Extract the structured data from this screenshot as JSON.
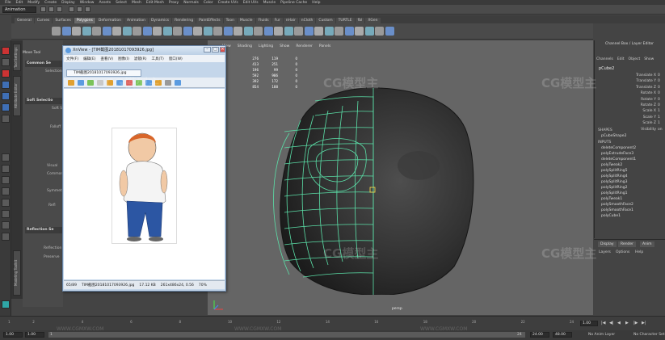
{
  "menubar": {
    "items": [
      "File",
      "Edit",
      "Modify",
      "Create",
      "Display",
      "Window",
      "Assets",
      "Select",
      "Mesh",
      "Edit Mesh",
      "Proxy",
      "Normals",
      "Color",
      "Create UVs",
      "Edit UVs",
      "Muscle",
      "Pipeline Cache",
      "Help"
    ]
  },
  "status": {
    "mode": "Animation"
  },
  "shelf": {
    "tabs": [
      "General",
      "Curves",
      "Surfaces",
      "Polygons",
      "Deformation",
      "Animation",
      "Dynamics",
      "Rendering",
      "PaintEffects",
      "Toon",
      "Muscle",
      "Fluids",
      "Fur",
      "nHair",
      "nCloth",
      "Custom",
      "TURTLE",
      "fbl",
      "XGen"
    ],
    "active": "Polygons"
  },
  "tool_settings": {
    "title": "Move Tool",
    "sections": [
      "Common Se",
      "Soft Selectio",
      "Reflection Se"
    ],
    "labels": [
      "Selection",
      "Soft S",
      "Falloff",
      "Visual",
      "Common",
      "Symmetry",
      "Refl",
      "Reflection",
      "Preserve"
    ]
  },
  "side_tabs": [
    "Tool Settings",
    "Attribute Editor",
    "Modeling Toolkit"
  ],
  "viewport": {
    "menu": [
      "View",
      "Shading",
      "Lighting",
      "Show",
      "Renderer",
      "Panels"
    ],
    "hud": [
      [
        "276",
        "119",
        "0"
      ],
      [
        "413",
        "251",
        "0"
      ],
      [
        "196",
        "99",
        "0"
      ],
      [
        "592",
        "986",
        "0"
      ],
      [
        "392",
        "172",
        "0"
      ],
      [
        "854",
        "188",
        "0"
      ]
    ],
    "camera": "persp",
    "accent": "#5be0a8"
  },
  "channel_box": {
    "title": "Channel Box / Layer Editor",
    "menu": [
      "Channels",
      "Edit",
      "Object",
      "Show"
    ],
    "object": "pCube2",
    "channels": [
      {
        "name": "Translate X",
        "value": "0"
      },
      {
        "name": "Translate Y",
        "value": "0"
      },
      {
        "name": "Translate Z",
        "value": "0"
      },
      {
        "name": "Rotate X",
        "value": "0"
      },
      {
        "name": "Rotate Y",
        "value": "0"
      },
      {
        "name": "Rotate Z",
        "value": "0"
      },
      {
        "name": "Scale X",
        "value": "1"
      },
      {
        "name": "Scale Y",
        "value": "1"
      },
      {
        "name": "Scale Z",
        "value": "1"
      },
      {
        "name": "Visibility",
        "value": "on"
      }
    ],
    "shapes_header": "SHAPES",
    "shape": "pCubeShape2",
    "inputs_header": "INPUTS",
    "inputs": [
      "deleteComponent2",
      "polyExtrudeFace3",
      "deleteComponent1",
      "polyTweak2",
      "polySplitRing5",
      "polySplitRing4",
      "polySplitRing3",
      "polySplitRing2",
      "polySplitRing1",
      "polyTweak1",
      "polySmoothFace2",
      "polySmoothFace1",
      "polyCube1"
    ]
  },
  "layer_editor": {
    "tabs": [
      "Display",
      "Render",
      "Anim"
    ],
    "menu": [
      "Layers",
      "Options",
      "Help"
    ]
  },
  "xnview": {
    "title": "XnView - [TIM截图20181017093926.jpg]",
    "menu": [
      "文件(F)",
      "编辑(E)",
      "查看(V)",
      "图像(I)",
      "滤镜(R)",
      "工具(T)",
      "窗口(W)"
    ],
    "tab": "TIM截图20181017093926.jpg",
    "status": [
      "65/89",
      "TIM截图20181017093926.jpg",
      "17.12 KB",
      "261x486x24, 0.56",
      "70%"
    ]
  },
  "timeline": {
    "ticks": [
      "1",
      "2",
      "4",
      "6",
      "8",
      "10",
      "12",
      "14",
      "16",
      "18",
      "20",
      "22",
      "24"
    ],
    "current": "1.00"
  },
  "range": {
    "start": "1.00",
    "inner_start": "1.00",
    "range_left": "1",
    "range_right": "24",
    "end": "24.00",
    "inner_end": "48.00",
    "anim_layer": "No Anim Layer",
    "char_set": "No Character Set"
  },
  "watermark": {
    "logo": "CG模型主",
    "url": "WWW.CGMXW.COM"
  }
}
